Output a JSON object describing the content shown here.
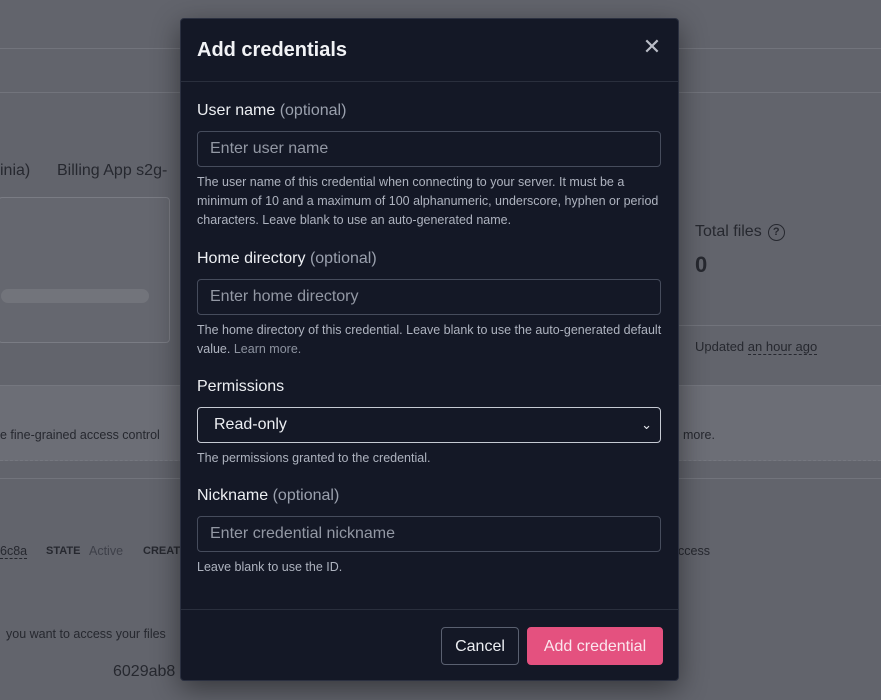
{
  "background": {
    "region_fragment": "inia)",
    "app_fragment": "Billing App  s2g-",
    "total_files_label": "Total files",
    "total_files_value": "0",
    "updated_prefix": "Updated",
    "updated_value": "an hour ago",
    "banner_left": "e fine-grained access control",
    "banner_right": "more.",
    "id_fragment": "6c8a",
    "state_label": "STATE",
    "state_value": "Active",
    "created_fragment": "CREAT",
    "access_fragment": "ccess",
    "bottom_text": "you want to access your files",
    "bottom_id": "6029ab8"
  },
  "modal": {
    "title": "Add credentials",
    "username": {
      "label": "User name",
      "optional": "(optional)",
      "placeholder": "Enter user name",
      "help": "The user name of this credential when connecting to your server. It must be a minimum of 10 and a maximum of 100 alphanumeric, underscore, hyphen or period characters. Leave blank to use an auto-generated name."
    },
    "home_directory": {
      "label": "Home directory",
      "optional": "(optional)",
      "placeholder": "Enter home directory",
      "help": "The home directory of this credential. Leave blank to use the auto-generated default value.",
      "help_link": "Learn more."
    },
    "permissions": {
      "label": "Permissions",
      "selected": "Read-only",
      "help": "The permissions granted to the credential."
    },
    "nickname": {
      "label": "Nickname",
      "optional": "(optional)",
      "placeholder": "Enter credential nickname",
      "help": "Leave blank to use the ID."
    },
    "cancel_label": "Cancel",
    "submit_label": "Add credential"
  },
  "colors": {
    "overlay": "#62646c",
    "modal_bg": "#141826",
    "primary_button": "#e4517f"
  }
}
